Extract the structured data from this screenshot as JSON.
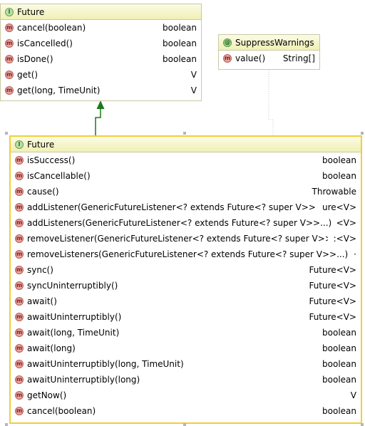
{
  "future_top": {
    "title": "Future",
    "kind_icon": "interface-icon",
    "methods": [
      {
        "name": "cancel(boolean)",
        "type": "boolean"
      },
      {
        "name": "isCancelled()",
        "type": "boolean"
      },
      {
        "name": "isDone()",
        "type": "boolean"
      },
      {
        "name": "get()",
        "type": "V"
      },
      {
        "name": "get(long, TimeUnit)",
        "type": "V"
      }
    ]
  },
  "suppress_warnings": {
    "title": "SuppressWarnings",
    "kind_icon": "annotation-icon",
    "methods": [
      {
        "name": "value()",
        "type": "String[]"
      }
    ]
  },
  "future_main": {
    "title": "Future",
    "kind_icon": "interface-icon",
    "methods": [
      {
        "name": "isSuccess()",
        "type": "boolean"
      },
      {
        "name": "isCancellable()",
        "type": "boolean"
      },
      {
        "name": "cause()",
        "type": "Throwable"
      },
      {
        "name": "addListener(GenericFutureListener<? extends Future<? super V>>)",
        "type": "ure<V>"
      },
      {
        "name": "addListeners(GenericFutureListener<? extends Future<? super V>>...)",
        "type": "<V>"
      },
      {
        "name": "removeListener(GenericFutureListener<? extends Future<? super V>>)",
        "type": ":<V>"
      },
      {
        "name": "removeListeners(GenericFutureListener<? extends Future<? super V>>...)",
        "type": "·"
      },
      {
        "name": "sync()",
        "type": "Future<V>"
      },
      {
        "name": "syncUninterruptibly()",
        "type": "Future<V>"
      },
      {
        "name": "await()",
        "type": "Future<V>"
      },
      {
        "name": "awaitUninterruptibly()",
        "type": "Future<V>"
      },
      {
        "name": "await(long, TimeUnit)",
        "type": "boolean"
      },
      {
        "name": "await(long)",
        "type": "boolean"
      },
      {
        "name": "awaitUninterruptibly(long, TimeUnit)",
        "type": "boolean"
      },
      {
        "name": "awaitUninterruptibly(long)",
        "type": "boolean"
      },
      {
        "name": "getNow()",
        "type": "V"
      },
      {
        "name": "cancel(boolean)",
        "type": "boolean"
      }
    ]
  },
  "icon_glyphs": {
    "method": "m",
    "interface": "I",
    "annotation": "@"
  },
  "colors": {
    "header_top": "#fbfbe6",
    "header_bottom": "#f0f0b4",
    "selection_border": "#f2cd3a",
    "inheritance_arrow": "#1a7a1a",
    "method_icon": "#e7a39f"
  }
}
